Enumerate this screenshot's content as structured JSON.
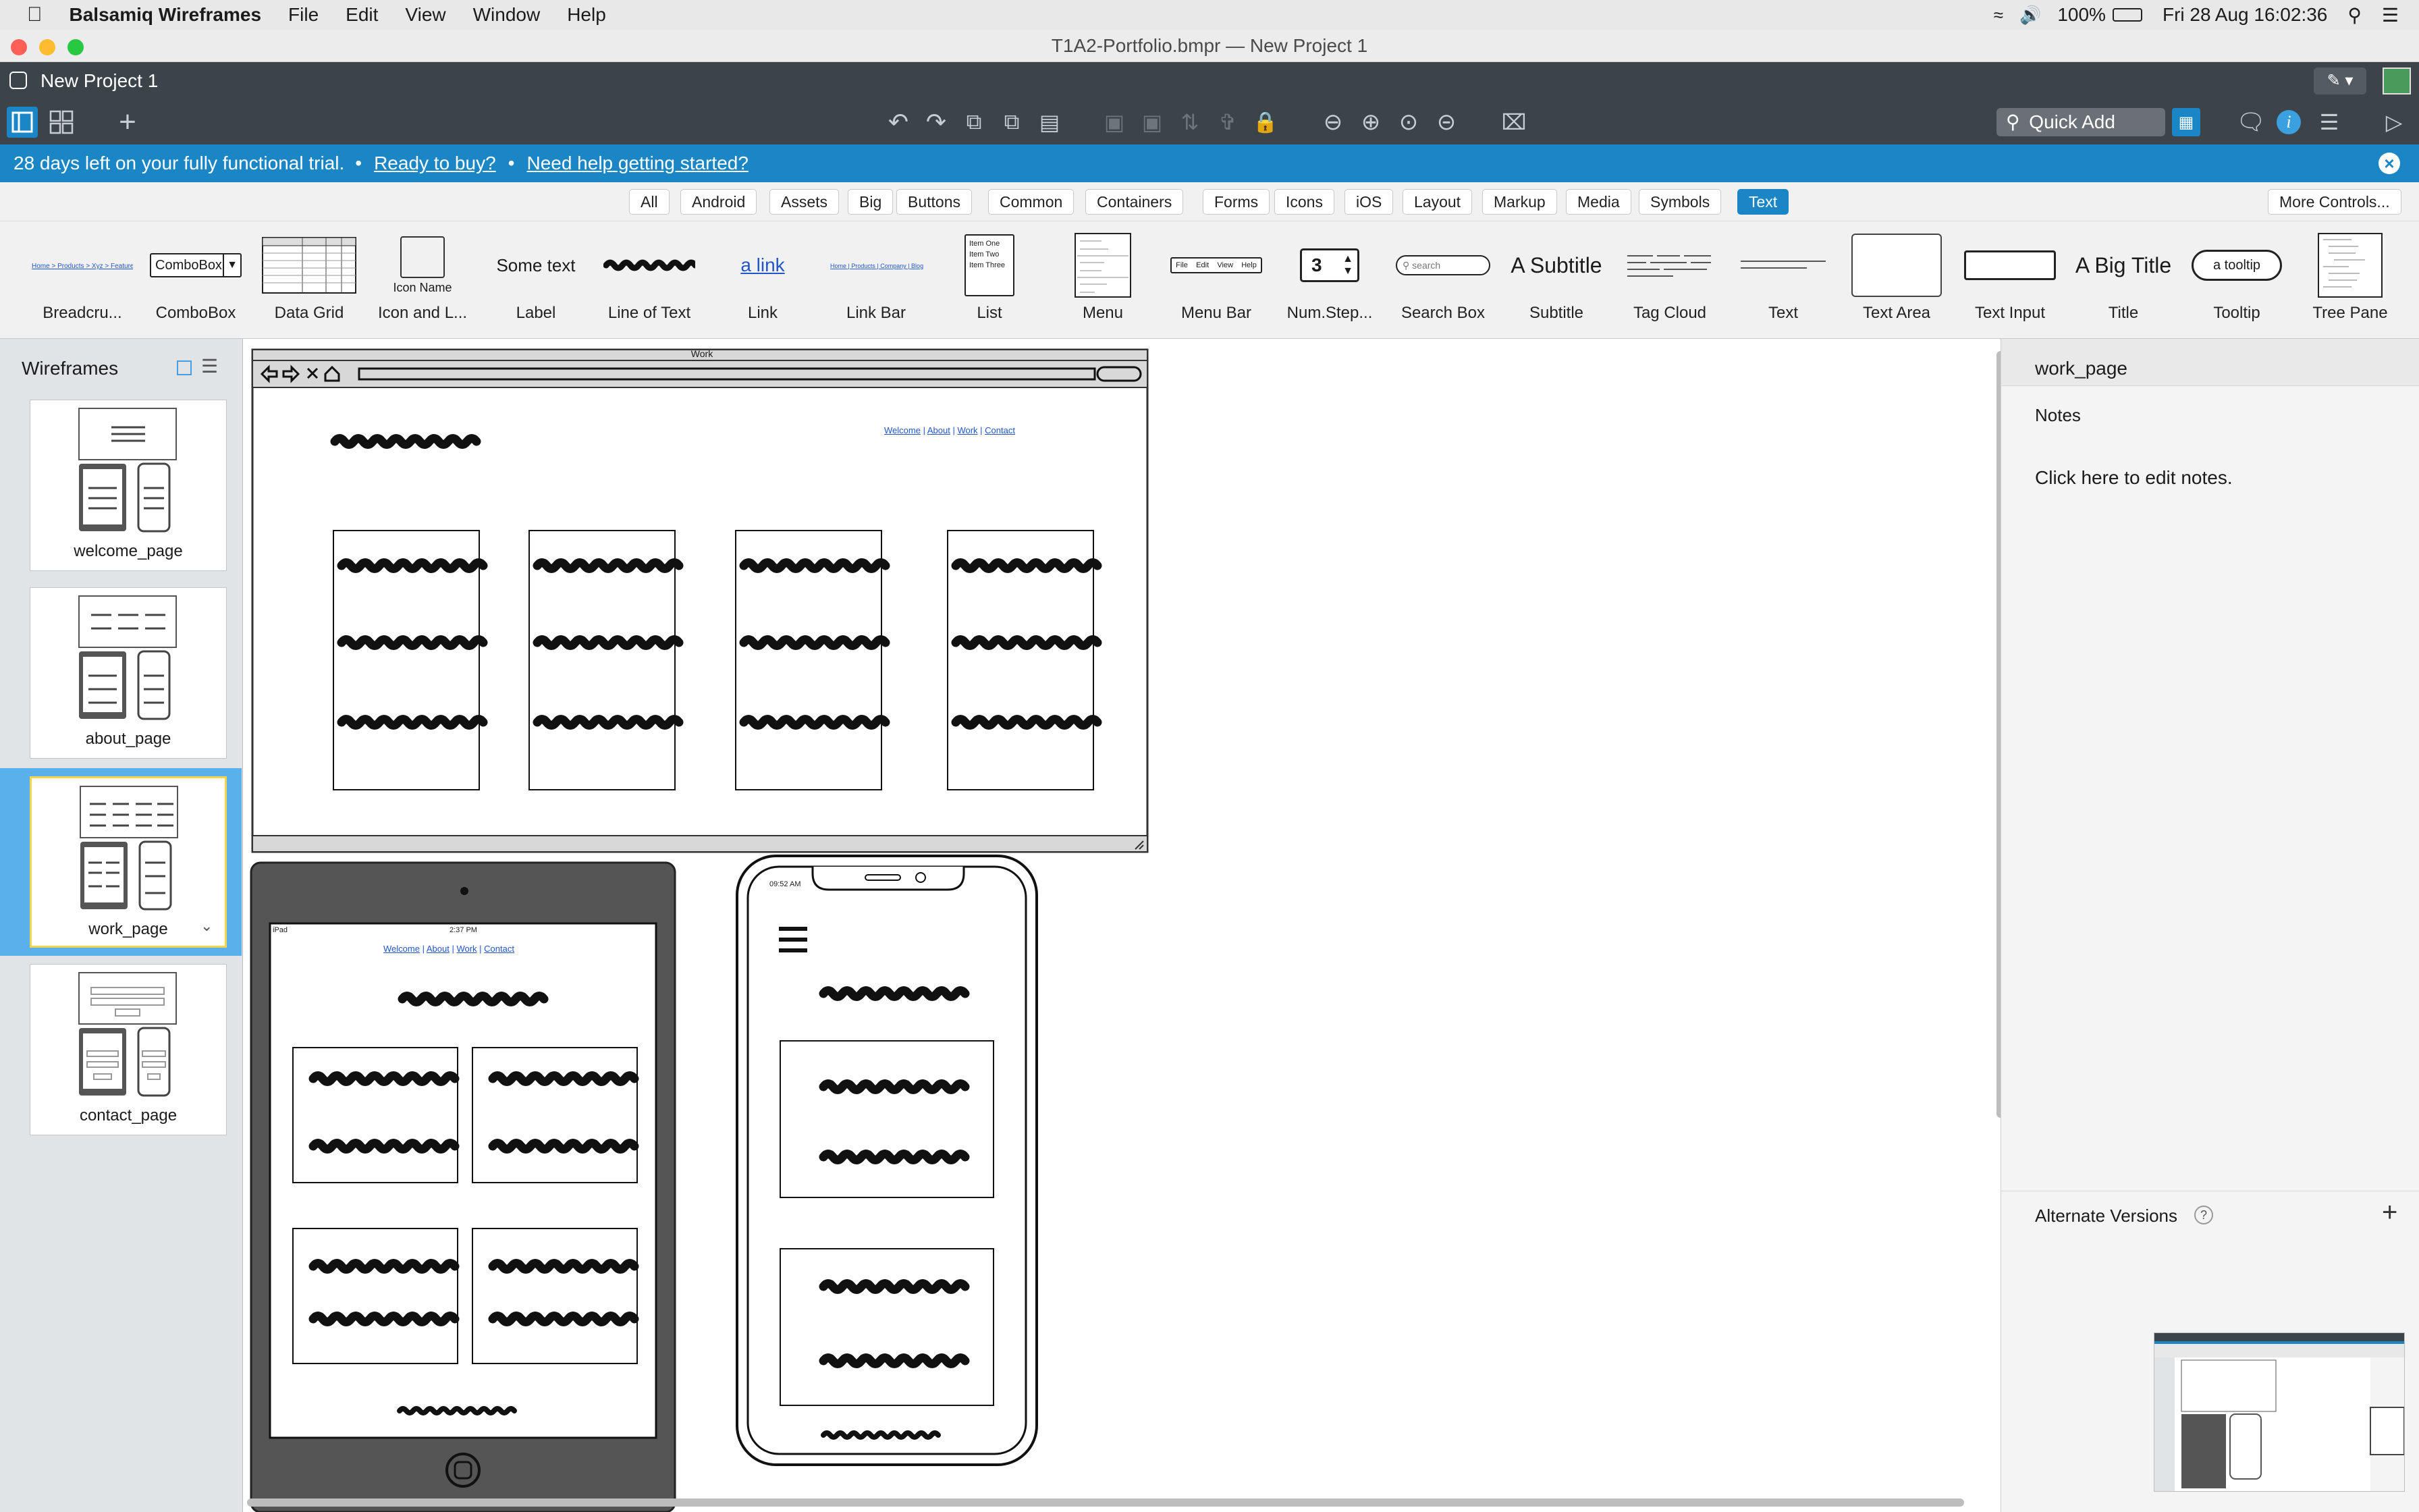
{
  "system_menu": {
    "app_name": "Balsamiq Wireframes",
    "items": [
      "File",
      "Edit",
      "View",
      "Window",
      "Help"
    ],
    "battery": "100%",
    "datetime": "Fri 28 Aug  16:02:36"
  },
  "window": {
    "title": "T1A2-Portfolio.bmpr — New Project 1"
  },
  "project": {
    "name": "New Project 1"
  },
  "toolbar": {
    "quick_add_placeholder": "Quick Add"
  },
  "trial": {
    "message": "28 days left on your fully functional trial.",
    "sep1": "•",
    "buy": "Ready to buy?",
    "sep2": "•",
    "help": "Need help getting started?"
  },
  "categories": [
    "All",
    "Android",
    "Assets",
    "Big",
    "Buttons",
    "Common",
    "Containers",
    "Forms",
    "Icons",
    "iOS",
    "Layout",
    "Markup",
    "Media",
    "Symbols",
    "Text"
  ],
  "selected_category": "Text",
  "more_controls": "More Controls...",
  "library": {
    "labels": [
      "Breadcru...",
      "ComboBox",
      "Data Grid",
      "Icon and L...",
      "Label",
      "Line of Text",
      "Link",
      "Link Bar",
      "List",
      "Menu",
      "Menu Bar",
      "Num.Step...",
      "Search Box",
      "Subtitle",
      "Tag Cloud",
      "Text",
      "Text Area",
      "Text Input",
      "Title",
      "Tooltip",
      "Tree Pane"
    ],
    "combobox_text": "ComboBox",
    "icon_name_text": "Icon Name",
    "label_text": "Some text",
    "link_text": "a link",
    "list_items": [
      "Item One",
      "Item Two",
      "Item Three"
    ],
    "menubar_items": [
      "File",
      "Edit",
      "View",
      "Help"
    ],
    "numstep_value": "3",
    "search_placeholder": "search",
    "subtitle_text": "A Subtitle",
    "title_text": "A Big Title",
    "tooltip_text": "a tooltip"
  },
  "sidebar": {
    "title": "Wireframes",
    "pages": [
      "welcome_page",
      "about_page",
      "work_page",
      "contact_page"
    ],
    "selected": "work_page"
  },
  "canvas": {
    "browser_title": "Work",
    "nav_links": [
      "Welcome",
      "About",
      "Work",
      "Contact"
    ],
    "tablet_status_left": "iPad",
    "tablet_time": "2:37 PM",
    "phone_time": "09:52 AM"
  },
  "right_panel": {
    "page_name": "work_page",
    "notes_label": "Notes",
    "notes_text": "Click here to edit notes.",
    "alternate_versions": "Alternate Versions",
    "help_mark": "?"
  },
  "colors": {
    "accent": "#1a86c6",
    "toolbar": "#3d4449",
    "selected_page": "#5ab0ea"
  }
}
